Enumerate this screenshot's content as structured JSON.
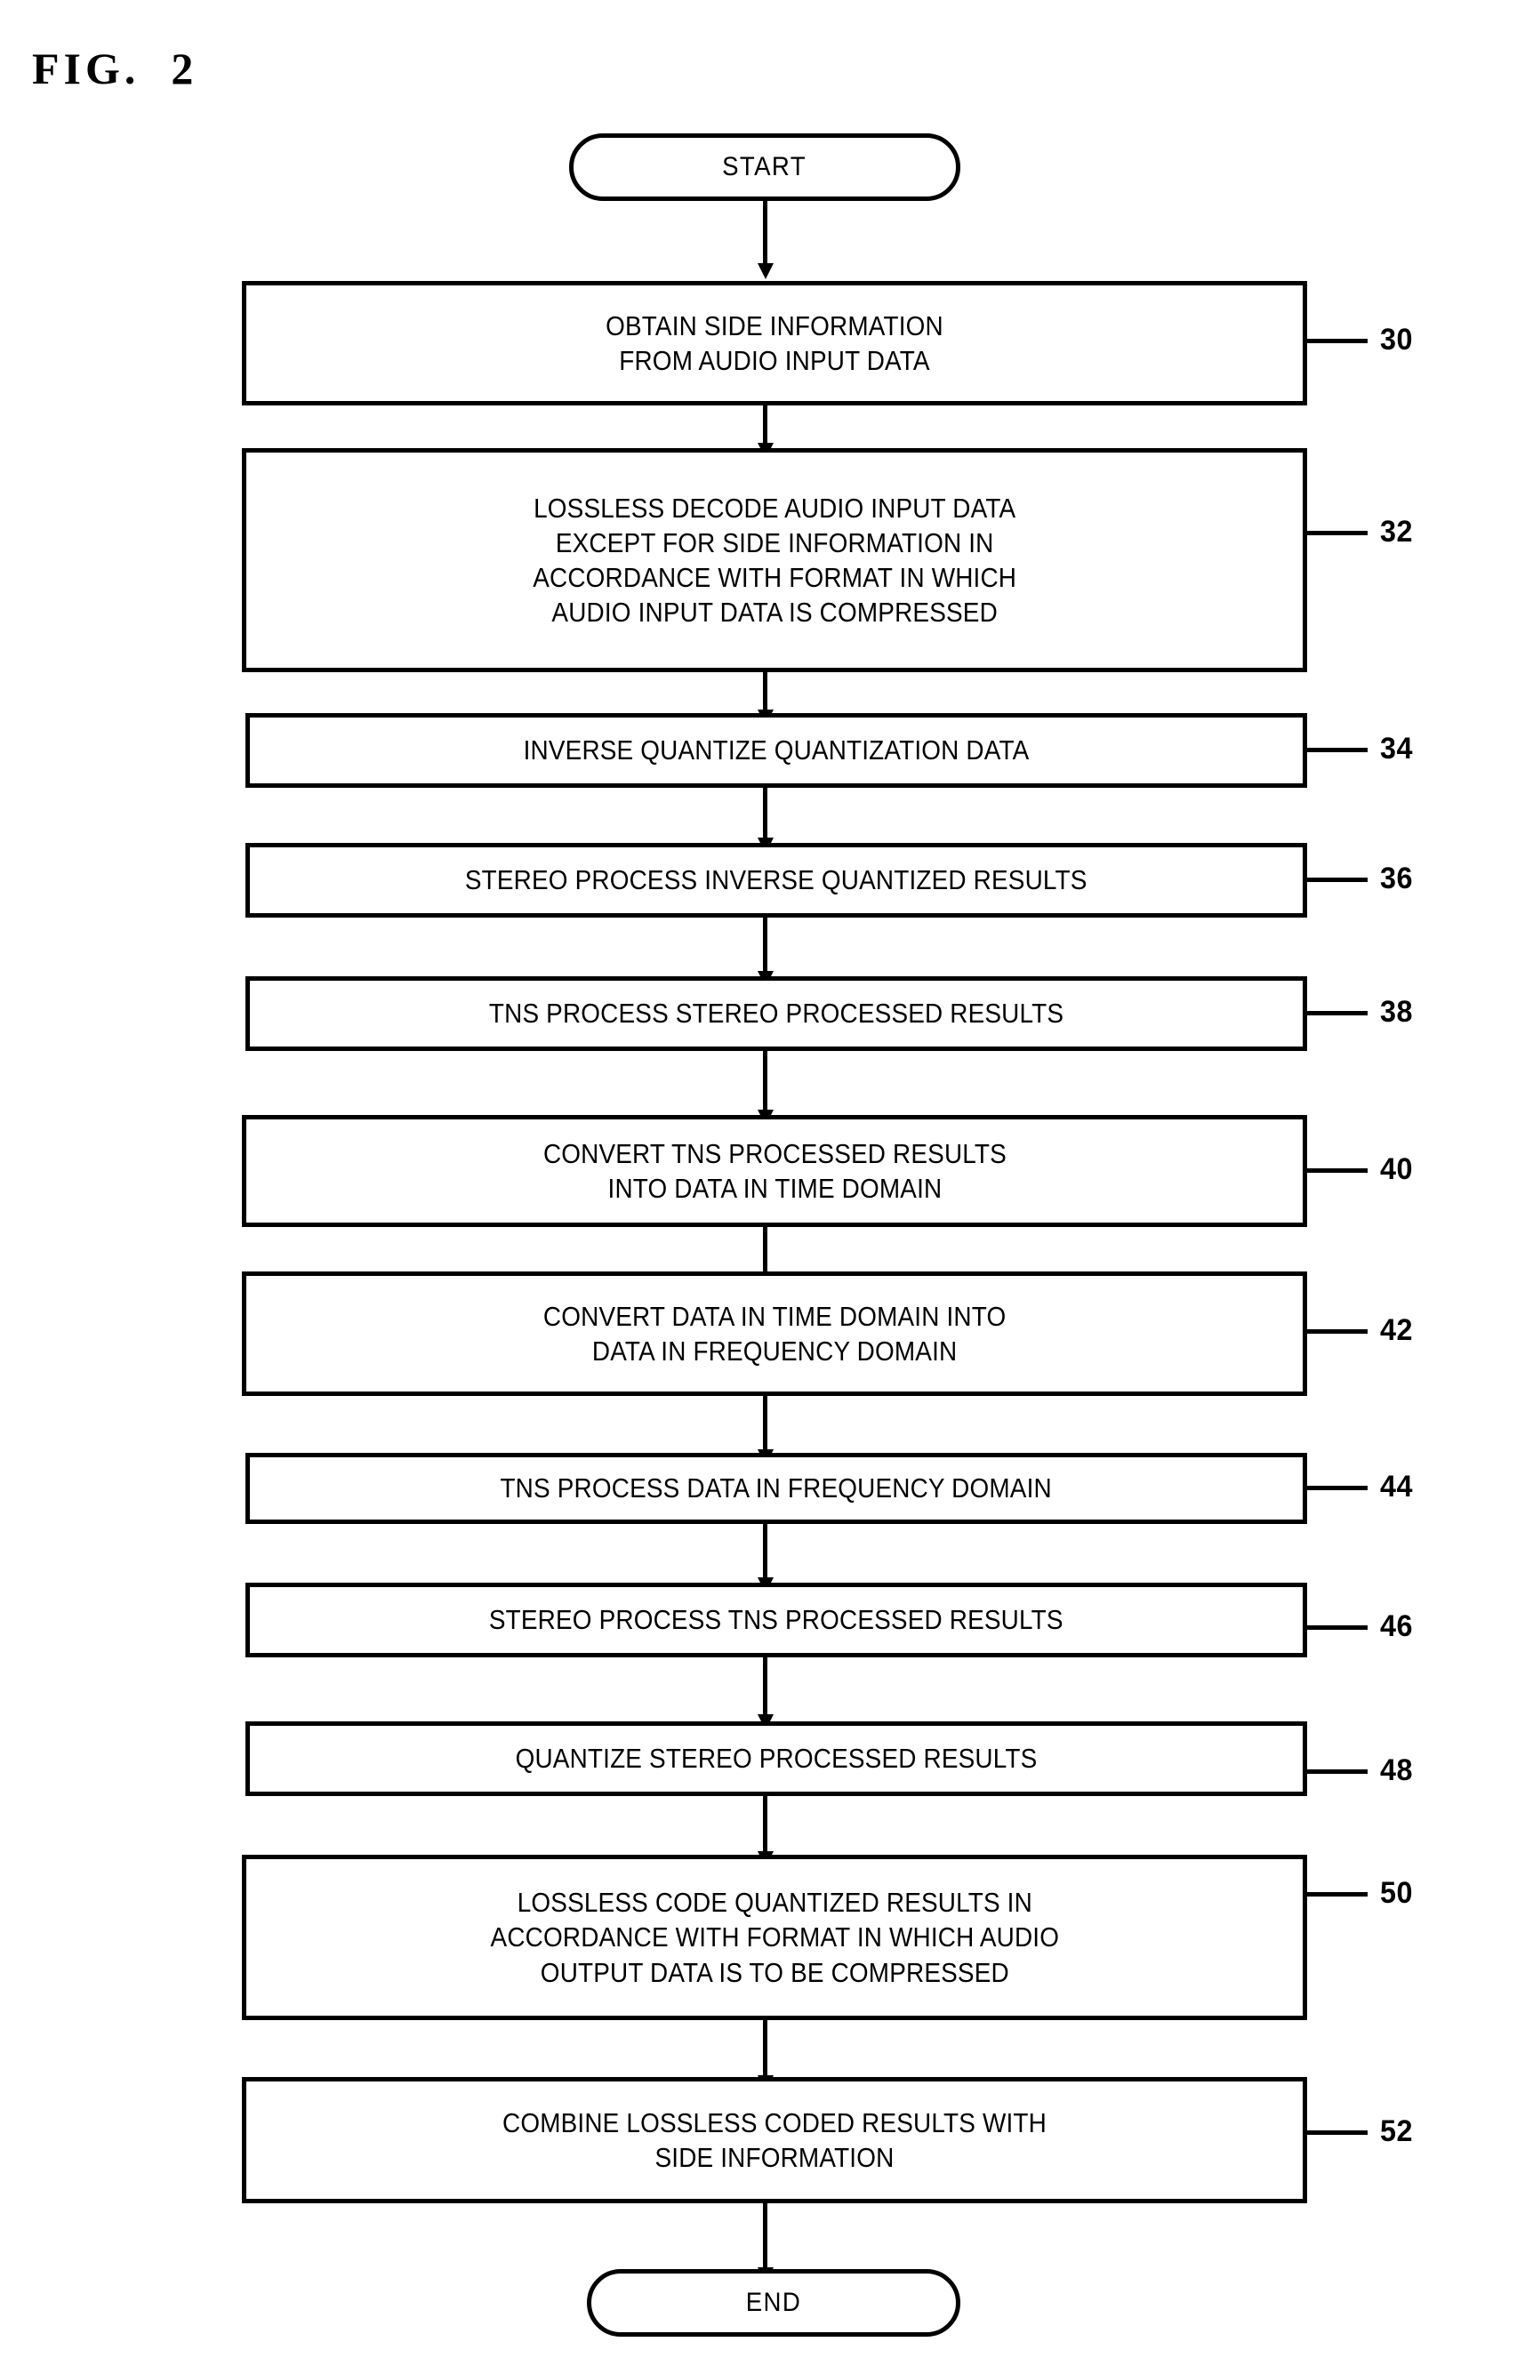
{
  "figure": {
    "label": "FIG.  2"
  },
  "terminators": {
    "start": "START",
    "end": "END"
  },
  "steps": [
    {
      "ref": "30",
      "text": "OBTAIN SIDE INFORMATION\nFROM AUDIO INPUT DATA"
    },
    {
      "ref": "32",
      "text": "LOSSLESS DECODE AUDIO INPUT DATA\nEXCEPT FOR SIDE INFORMATION IN\nACCORDANCE  WITH FORMAT IN WHICH\nAUDIO INPUT DATA IS COMPRESSED"
    },
    {
      "ref": "34",
      "text": "INVERSE QUANTIZE QUANTIZATION DATA"
    },
    {
      "ref": "36",
      "text": "STEREO PROCESS INVERSE QUANTIZED RESULTS"
    },
    {
      "ref": "38",
      "text": "TNS PROCESS STEREO PROCESSED RESULTS"
    },
    {
      "ref": "40",
      "text": "CONVERT TNS PROCESSED RESULTS\nINTO DATA IN TIME DOMAIN"
    },
    {
      "ref": "42",
      "text": "CONVERT DATA IN TIME DOMAIN INTO\nDATA IN FREQUENCY DOMAIN"
    },
    {
      "ref": "44",
      "text": "TNS PROCESS DATA IN FREQUENCY DOMAIN"
    },
    {
      "ref": "46",
      "text": "STEREO PROCESS TNS PROCESSED RESULTS"
    },
    {
      "ref": "48",
      "text": "QUANTIZE STEREO PROCESSED RESULTS"
    },
    {
      "ref": "50",
      "text": "LOSSLESS CODE QUANTIZED RESULTS IN\nACCORDANCE WITH FORMAT IN WHICH AUDIO\nOUTPUT DATA IS TO BE COMPRESSED"
    },
    {
      "ref": "52",
      "text": "COMBINE LOSSLESS CODED RESULTS WITH\nSIDE  INFORMATION"
    }
  ],
  "colors": {
    "ink": "#000000",
    "paper": "#ffffff"
  }
}
